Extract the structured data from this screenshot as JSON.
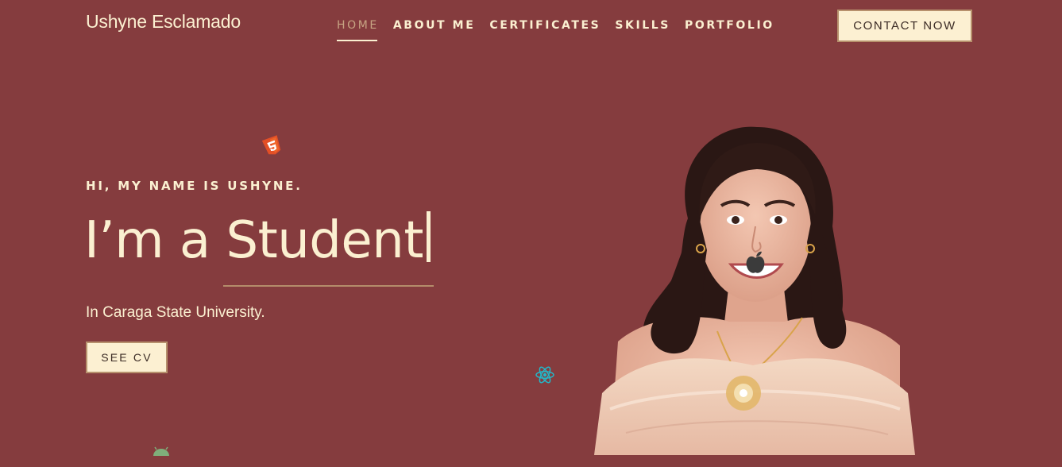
{
  "brand": "Ushyne Esclamado",
  "nav": {
    "items": [
      {
        "label": "HOME",
        "active": true
      },
      {
        "label": "ABOUT ME",
        "active": false
      },
      {
        "label": "CERTIFICATES",
        "active": false
      },
      {
        "label": "SKILLS",
        "active": false
      },
      {
        "label": "PORTFOLIO",
        "active": false
      }
    ],
    "contact_label": "CONTACT NOW"
  },
  "hero": {
    "greeting": "HI, MY NAME IS USHYNE.",
    "headline_prefix": "I’m a ",
    "headline_role": "Student",
    "subtext": "In Caraga State University.",
    "cv_label": "SEE CV"
  },
  "icons": [
    "html5-icon",
    "react-icon",
    "android-icon",
    "apple-icon"
  ],
  "colors": {
    "background": "#853c3e",
    "cream": "#fbf0d1",
    "accent": "#c7a483"
  }
}
